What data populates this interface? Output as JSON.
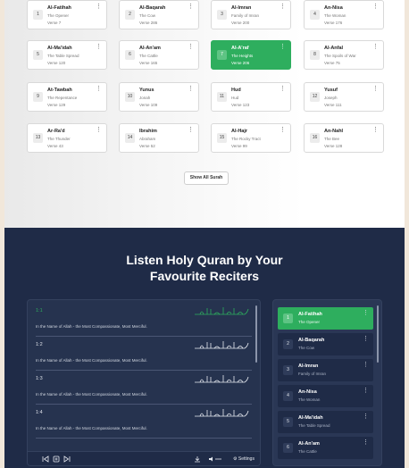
{
  "surah_grid": [
    {
      "num": "1",
      "name": "Al-Fatihah",
      "meaning": "The Opener",
      "verse": "Verse 7"
    },
    {
      "num": "2",
      "name": "Al-Baqarah",
      "meaning": "The Cow",
      "verse": "Verse 286"
    },
    {
      "num": "3",
      "name": "Al-Imran",
      "meaning": "Family of Imran",
      "verse": "Verse 200"
    },
    {
      "num": "4",
      "name": "An-Nisa",
      "meaning": "The Woman",
      "verse": "Verse 176"
    },
    {
      "num": "5",
      "name": "Al-Ma'idah",
      "meaning": "The Table Spread",
      "verse": "Verse 120"
    },
    {
      "num": "6",
      "name": "Al-An'am",
      "meaning": "The Cattle",
      "verse": "Verse 165"
    },
    {
      "num": "7",
      "name": "Al-A'raf",
      "meaning": "The Heights",
      "verse": "Verse 206",
      "active": true
    },
    {
      "num": "8",
      "name": "Al-Anfal",
      "meaning": "The Spoils of War",
      "verse": "Verse 75"
    },
    {
      "num": "9",
      "name": "At-Tawbah",
      "meaning": "The Repentance",
      "verse": "Verse 129"
    },
    {
      "num": "10",
      "name": "Yunus",
      "meaning": "Jonah",
      "verse": "Verse 109"
    },
    {
      "num": "11",
      "name": "Hud",
      "meaning": "Hud",
      "verse": "Verse 123"
    },
    {
      "num": "12",
      "name": "Yusuf",
      "meaning": "Joseph",
      "verse": "Verse 111"
    },
    {
      "num": "13",
      "name": "Ar-Ra'd",
      "meaning": "The Thunder",
      "verse": "Verse 43"
    },
    {
      "num": "14",
      "name": "Ibrahim",
      "meaning": "Abraham",
      "verse": "Verse 52"
    },
    {
      "num": "15",
      "name": "Al-Hajr",
      "meaning": "The Rocky Tract",
      "verse": "Verse 99"
    },
    {
      "num": "16",
      "name": "An-Nahl",
      "meaning": "The Bee",
      "verse": "Verse 128"
    }
  ],
  "show_all_label": "Show All Surah",
  "reciters_heading_line1": "Listen Holy Quran by Your",
  "reciters_heading_line2": "Favourite Reciters",
  "ayahs": [
    {
      "ref": "1:1",
      "translation": "In the Name of Allah - the Most Compassionate, Most Merciful.",
      "active": true
    },
    {
      "ref": "1:2",
      "translation": "In the Name of Allah - the Most Compassionate, Most Merciful."
    },
    {
      "ref": "1:3",
      "translation": "In the Name of Allah - the Most Compassionate, Most Merciful."
    },
    {
      "ref": "1:4",
      "translation": "In the Name of Allah - the Most Compassionate, Most Merciful."
    }
  ],
  "player_controls": {
    "prev_icon": "previous-icon",
    "play_icon": "pause-icon",
    "next_icon": "next-icon",
    "download_icon": "download-icon",
    "volume_icon": "volume-icon",
    "settings_label": "Settings"
  },
  "reciter_list": [
    {
      "num": "1",
      "name": "Al-Fatihah",
      "meaning": "The Opener",
      "active": true
    },
    {
      "num": "2",
      "name": "Al-Baqarah",
      "meaning": "The Cow"
    },
    {
      "num": "3",
      "name": "Al-Imran",
      "meaning": "Family of Imran"
    },
    {
      "num": "4",
      "name": "An-Nisa",
      "meaning": "The Woman"
    },
    {
      "num": "5",
      "name": "Al-Ma'idah",
      "meaning": "The Table Spread"
    },
    {
      "num": "6",
      "name": "Al-An'am",
      "meaning": "The Cattle"
    }
  ],
  "colors": {
    "accent": "#2eae5e",
    "navy": "#1f2b47",
    "panel": "#26334f"
  }
}
